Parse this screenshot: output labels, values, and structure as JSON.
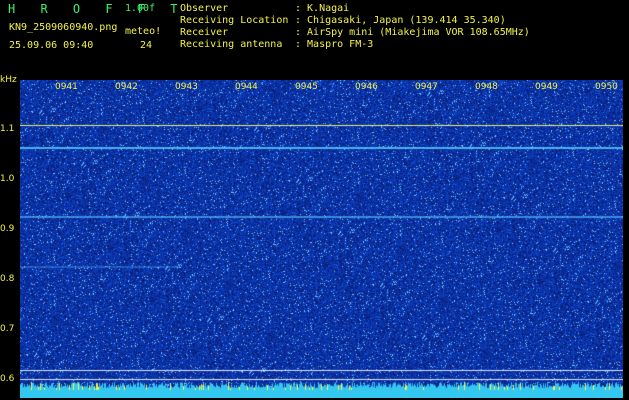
{
  "header": {
    "app_title": "H R O F F T",
    "version": "1.00f",
    "filename": "KN9_2509060940.png",
    "datetime": "25.09.06 09:40",
    "meteor_label": "meteo!",
    "meteor_count": "24"
  },
  "meta": [
    {
      "label": "Observer",
      "value": ": K.Nagai"
    },
    {
      "label": "Receiving Location",
      "value": ": Chigasaki, Japan (139.414 35.340)"
    },
    {
      "label": "Receiver",
      "value": ": AirSpy mini (Miakejima VOR 108.65MHz)"
    },
    {
      "label": "Receiving antenna",
      "value": ": Maspro FM-3"
    }
  ],
  "axis": {
    "y_unit": "kHz",
    "y_ticks": [
      "1.1",
      "1.0",
      "0.9",
      "0.8",
      "0.7",
      "0.6"
    ],
    "x_ticks": [
      "0941",
      "0942",
      "0943",
      "0944",
      "0945",
      "0946",
      "0947",
      "0948",
      "0949",
      "0950"
    ]
  },
  "colors": {
    "text": "#f4f24a",
    "title": "#3cf06a",
    "background_noise": "#1a2fa8",
    "noise_floor_bar": "#33c8f0"
  }
}
